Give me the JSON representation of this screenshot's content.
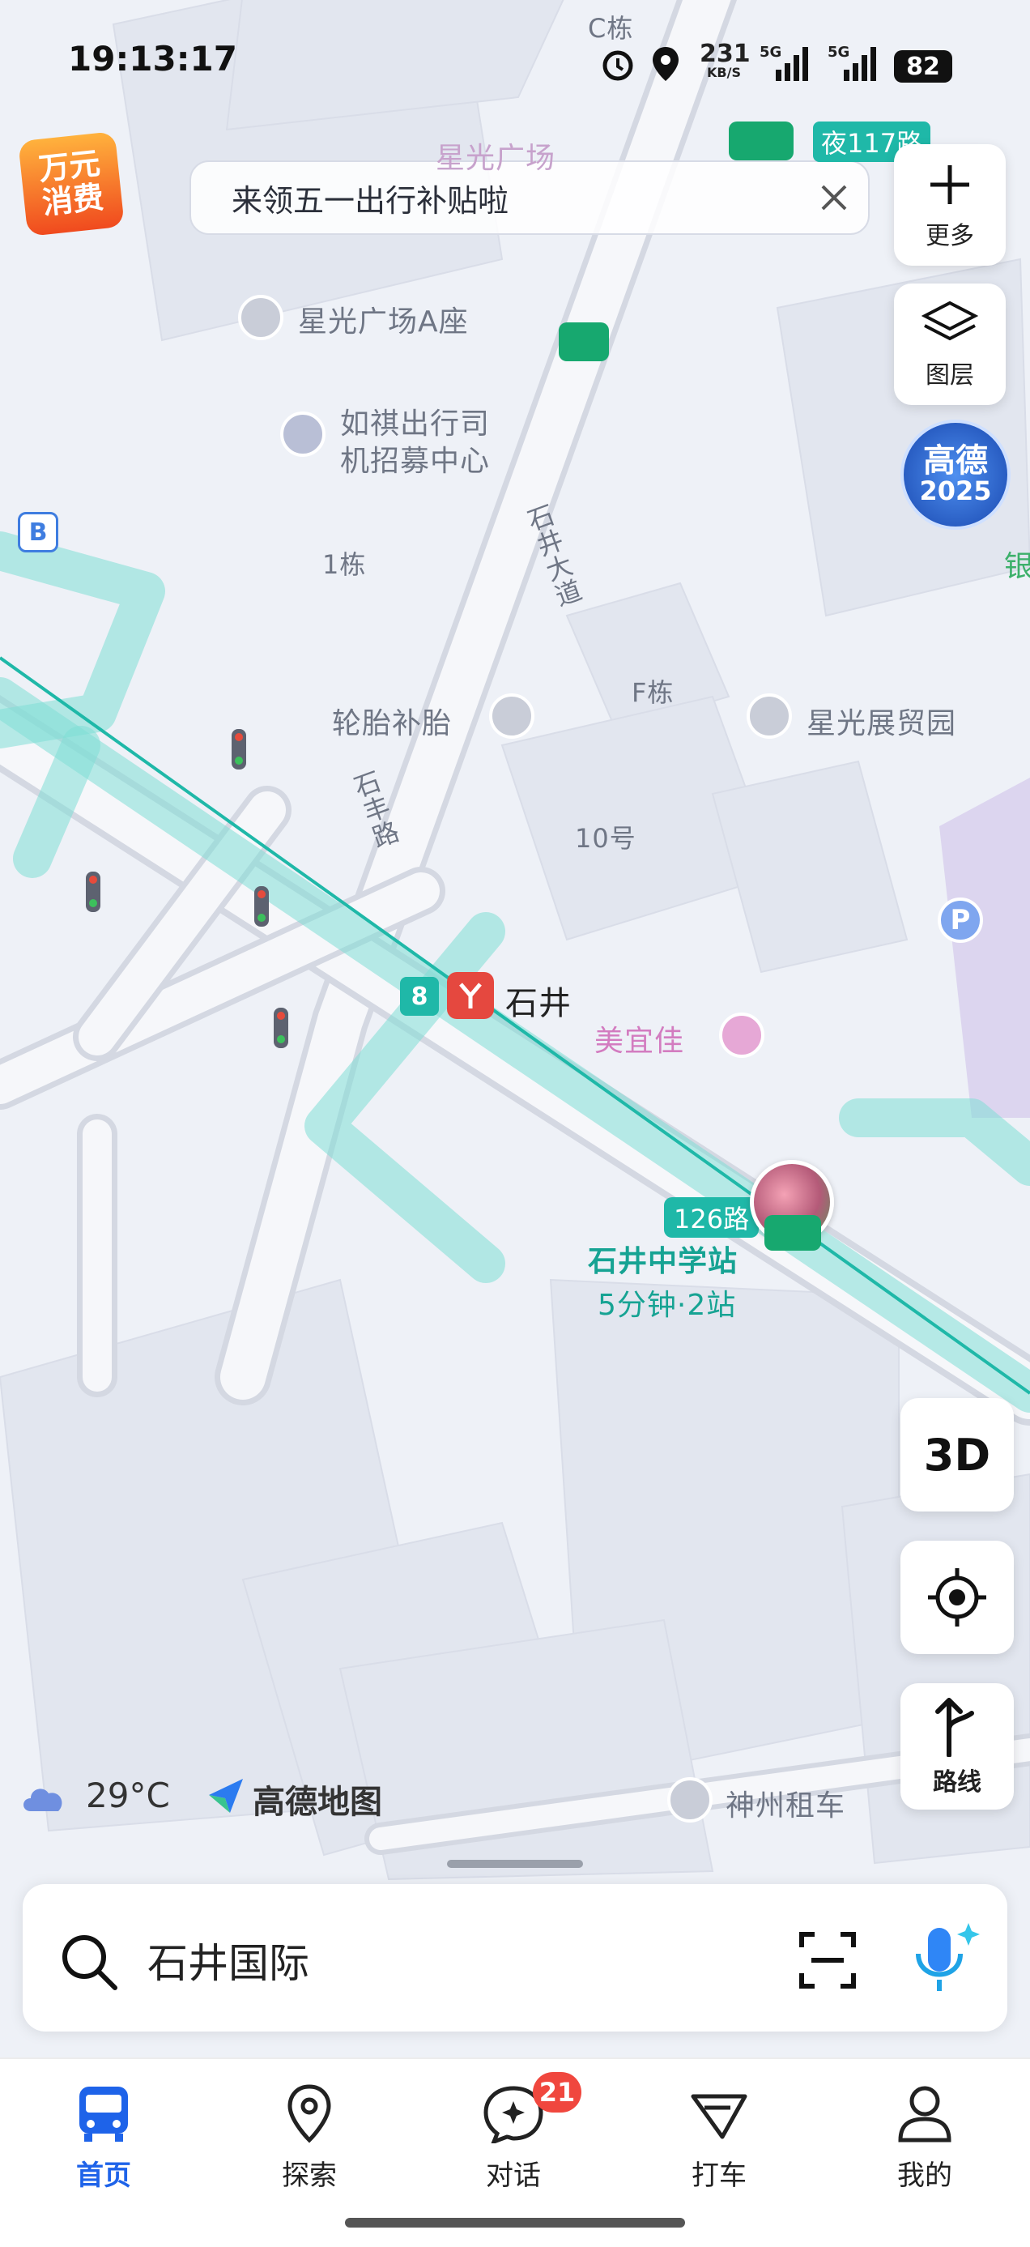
{
  "status_bar": {
    "time": "19:13:17",
    "net_speed_value": "231",
    "net_speed_unit": "KB/S",
    "sig1": "5G",
    "sig2": "5G",
    "battery": "82"
  },
  "promo": {
    "badge_line1": "万元",
    "badge_line2": "消费"
  },
  "banner": {
    "text": "来领五一出行补贴啦"
  },
  "map_labels": {
    "c_building": "C栋",
    "star_plaza": "星光广场",
    "star_plaza_a": "星光广场A座",
    "ruqi_line1": "如祺出行司",
    "ruqi_line2": "机招募中心",
    "shijing_road": "石井大道",
    "building1": "1栋",
    "building_f": "F栋",
    "tire": "轮胎补胎",
    "star_expo": "星光展贸园",
    "shifeng_road": "石丰路",
    "no10": "10号",
    "metro_line": "8",
    "metro_station": "石井",
    "meiyijia": "美宜佳",
    "bus_126": "126路",
    "bus_station": "石井中学站",
    "bus_eta": "5分钟·2站",
    "bus_night117": "夜117路",
    "bank": "银",
    "shenzhou": "神州租车"
  },
  "right_controls": {
    "more_label": "更多",
    "layers_label": "图层",
    "gaode_line1": "高德",
    "gaode_line2": "2025",
    "three_d": "3D",
    "route_label": "路线"
  },
  "weather": {
    "temp": "29°C",
    "brand": "高德地图"
  },
  "search": {
    "text": "石井国际"
  },
  "tabs": [
    {
      "label": "首页",
      "icon": "bus-icon"
    },
    {
      "label": "探索",
      "icon": "location-pin-icon"
    },
    {
      "label": "对话",
      "icon": "chat-icon",
      "badge": "21"
    },
    {
      "label": "打车",
      "icon": "taxi-icon"
    },
    {
      "label": "我的",
      "icon": "person-icon"
    }
  ],
  "colors": {
    "accent_blue": "#1e63e9",
    "transit_teal": "#1fb8a8",
    "metro_red": "#e5483f",
    "badge_red": "#f0473e"
  }
}
